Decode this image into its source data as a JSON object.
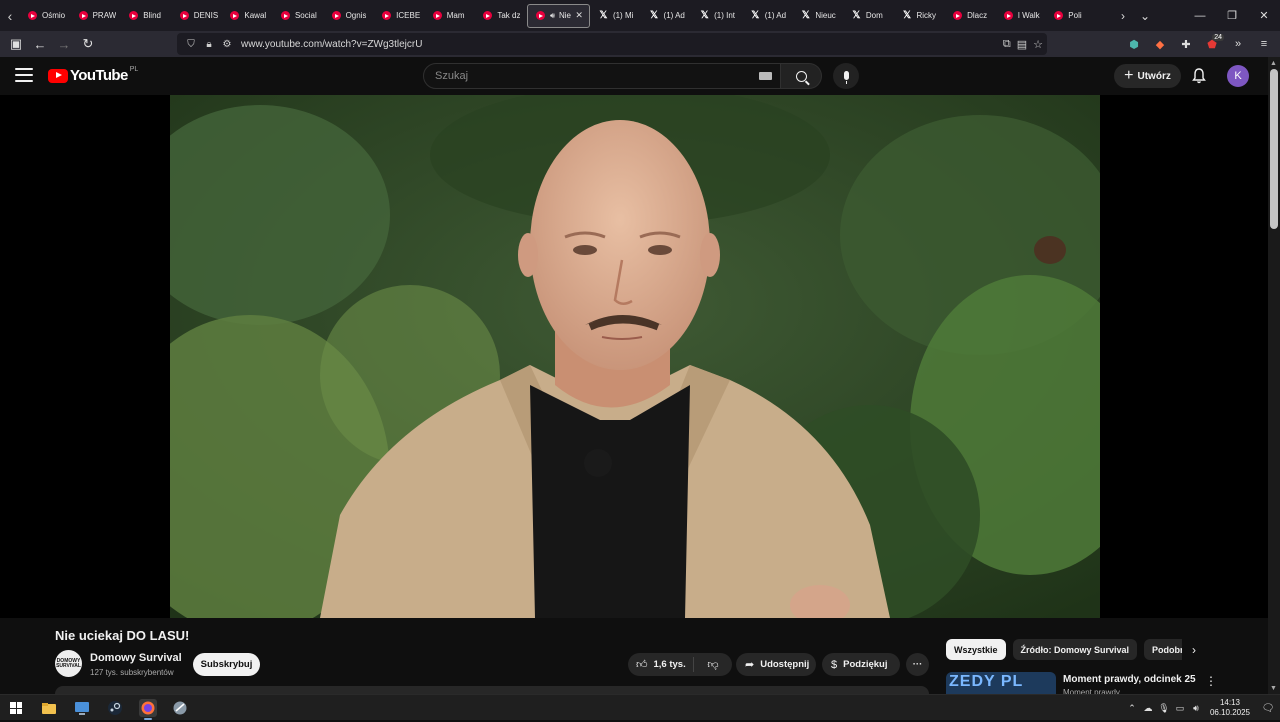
{
  "browser": {
    "tabs": [
      {
        "label": "Ośmio",
        "icon": "youtube"
      },
      {
        "label": "PRAW",
        "icon": "youtube"
      },
      {
        "label": "Blind",
        "icon": "youtube"
      },
      {
        "label": "DENIS",
        "icon": "youtube"
      },
      {
        "label": "Kawal",
        "icon": "youtube"
      },
      {
        "label": "Social",
        "icon": "youtube"
      },
      {
        "label": "Ognis",
        "icon": "youtube"
      },
      {
        "label": "ICEBE",
        "icon": "youtube"
      },
      {
        "label": "Mam",
        "icon": "youtube"
      },
      {
        "label": "Tak dz",
        "icon": "youtube"
      },
      {
        "label": "Nie",
        "icon": "youtube",
        "active": true
      },
      {
        "label": "(1) Mi",
        "icon": "x"
      },
      {
        "label": "(1) Ad",
        "icon": "x"
      },
      {
        "label": "(1) Int",
        "icon": "x"
      },
      {
        "label": "(1) Ad",
        "icon": "x"
      },
      {
        "label": "Nieuc",
        "icon": "x"
      },
      {
        "label": "Dom",
        "icon": "x"
      },
      {
        "label": "Ricky",
        "icon": "x"
      },
      {
        "label": "Dlacz",
        "icon": "youtube"
      },
      {
        "label": "I Walk",
        "icon": "youtube"
      },
      {
        "label": "Poli",
        "icon": "youtube"
      }
    ],
    "tab_close_glyph": "✕",
    "address": {
      "url": "www.youtube.com/watch?v=ZWg3tlejcrU"
    },
    "extension_badge": "24"
  },
  "youtube": {
    "logo_text": "YouTube",
    "logo_country": "PL",
    "search_placeholder": "Szukaj",
    "create_label": "Utwórz",
    "avatar_letter": "K",
    "video": {
      "title": "Nie uciekaj DO LASU!",
      "channel_name": "Domowy Survival",
      "channel_subscribers": "127 tys. subskrybentów",
      "channel_avatar_text": "DOMOWY SURVIVAL",
      "subscribe_label": "Subskrybuj",
      "likes": "1,6 tys.",
      "share_label": "Udostępnij",
      "thanks_label": "Podziękuj"
    },
    "chips": [
      {
        "label": "Wszystkie",
        "active": true
      },
      {
        "label": "Źródło: Domowy Survival",
        "active": false
      },
      {
        "label": "Podobne",
        "active": false
      }
    ],
    "recommendation": {
      "title": "Moment prawdy, odcinek 25",
      "channel": "Moment prawdy",
      "thumb_text": "ZEDY PL"
    }
  },
  "taskbar": {
    "time": "14:13",
    "date": "06.10.2025"
  },
  "colors": {
    "yt_red": "#ff0000",
    "bg": "#0f0f0f",
    "avatar_purple": "#7e57c2"
  }
}
